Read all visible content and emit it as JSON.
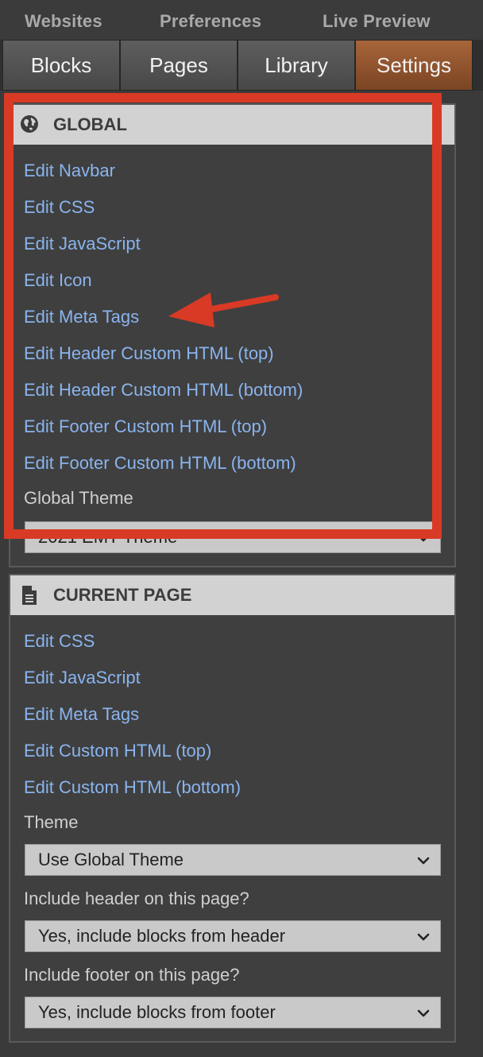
{
  "topnav": {
    "websites": "Websites",
    "preferences": "Preferences",
    "live_preview": "Live Preview"
  },
  "tabs": [
    {
      "label": "Blocks"
    },
    {
      "label": "Pages"
    },
    {
      "label": "Library"
    },
    {
      "label": "Settings",
      "active": true
    }
  ],
  "global": {
    "title": "GLOBAL",
    "icon": "globe-icon",
    "links": [
      "Edit Navbar",
      "Edit CSS",
      "Edit JavaScript",
      "Edit Icon",
      "Edit Meta Tags",
      "Edit Header Custom HTML (top)",
      "Edit Header Custom HTML (bottom)",
      "Edit Footer Custom HTML (top)",
      "Edit Footer Custom HTML (bottom)"
    ],
    "theme_label": "Global Theme",
    "theme_value": "2021 EMT Theme"
  },
  "current_page": {
    "title": "CURRENT PAGE",
    "icon": "document-icon",
    "links": [
      "Edit CSS",
      "Edit JavaScript",
      "Edit Meta Tags",
      "Edit Custom HTML (top)",
      "Edit Custom HTML (bottom)"
    ],
    "theme_label": "Theme",
    "theme_value": "Use Global Theme",
    "header_label": "Include header on this page?",
    "header_value": "Yes, include blocks from header",
    "footer_label": "Include footer on this page?",
    "footer_value": "Yes, include blocks from footer"
  },
  "colors": {
    "accent_tab": "#a8653a",
    "link": "#8ab4ee",
    "highlight": "#d93a25"
  }
}
